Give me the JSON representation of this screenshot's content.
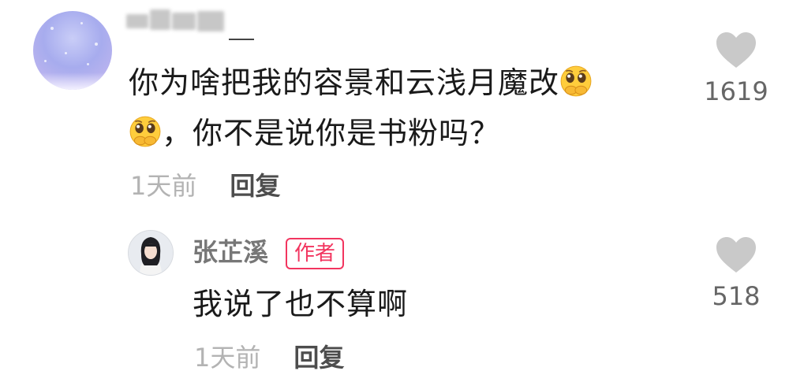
{
  "main_comment": {
    "text_line1": "你为啥把我的容景和云浅月魔改",
    "text_line2": "，你不是说你是书粉吗？",
    "time": "1天前",
    "reply_label": "回复",
    "likes": "1619",
    "emoji_icon": "pleading-face-hands-over-mouth-icon"
  },
  "reply": {
    "username": "张芷溪",
    "badge": "作者",
    "text": "我说了也不算啊",
    "time": "1天前",
    "reply_label": "回复",
    "likes": "518"
  },
  "colors": {
    "badge": "#f2355f",
    "like_icon": "#c9c9c9",
    "meta_text": "#b3b3b3"
  }
}
